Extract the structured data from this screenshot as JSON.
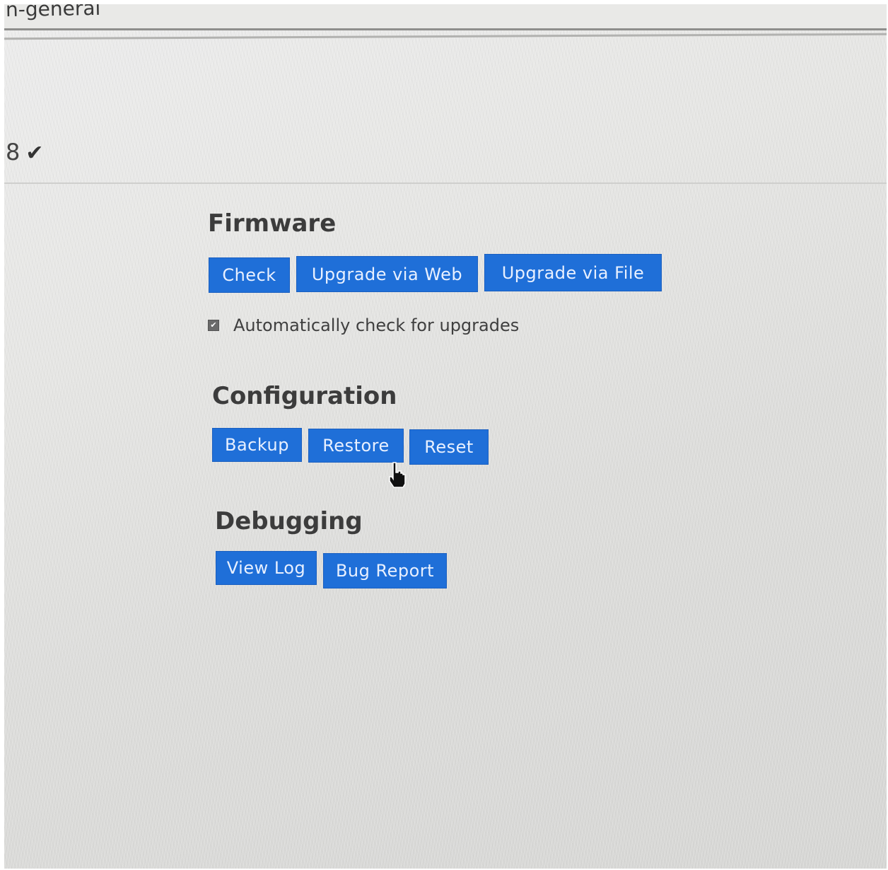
{
  "header": {
    "breadcrumb": "n-general"
  },
  "status": {
    "text": "8"
  },
  "firmware": {
    "heading": "Firmware",
    "buttons": {
      "check": "Check",
      "upgrade_web": "Upgrade via Web",
      "upgrade_file": "Upgrade via File"
    },
    "auto_check": {
      "label": "Automatically check for upgrades",
      "checked": true
    }
  },
  "configuration": {
    "heading": "Configuration",
    "buttons": {
      "backup": "Backup",
      "restore": "Restore",
      "reset": "Reset"
    }
  },
  "debugging": {
    "heading": "Debugging",
    "buttons": {
      "view_log": "View Log",
      "bug_report": "Bug Report"
    }
  },
  "colors": {
    "button_bg": "#1f6fd8",
    "button_text": "#e8f0ff",
    "heading": "#3c3c3c"
  },
  "icons": {
    "status": "checkmark-icon",
    "cursor": "hand-pointer-cursor-icon",
    "checkbox": "checkbox-checked-icon"
  }
}
